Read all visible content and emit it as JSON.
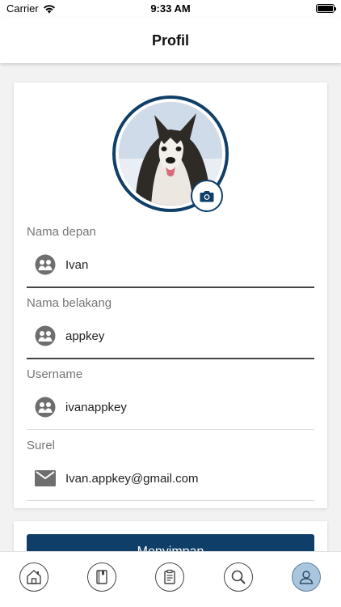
{
  "status_bar": {
    "carrier": "Carrier",
    "time": "9:33 AM",
    "battery_level": 1.0
  },
  "header": {
    "title": "Profil"
  },
  "profile": {
    "avatar_alt": "Profile photo",
    "camera_icon": "camera-icon",
    "fields": [
      {
        "label": "Nama depan",
        "value": "Ivan",
        "icon": "person-icon"
      },
      {
        "label": "Nama belakang",
        "value": "appkey",
        "icon": "person-icon"
      },
      {
        "label": "Username",
        "value": "ivanappkey",
        "icon": "person-icon"
      },
      {
        "label": "Surel",
        "value": "Ivan.appkey@gmail.com",
        "icon": "mail-icon"
      }
    ]
  },
  "actions": {
    "save_label": "Menyimpan"
  },
  "tab_bar": {
    "items": [
      {
        "icon": "home-icon"
      },
      {
        "icon": "book-icon"
      },
      {
        "icon": "clipboard-icon"
      },
      {
        "icon": "search-icon"
      },
      {
        "icon": "profile-icon",
        "active": true
      }
    ]
  },
  "colors": {
    "accent": "#0f3f69",
    "active_tab": "#a9c6de"
  }
}
